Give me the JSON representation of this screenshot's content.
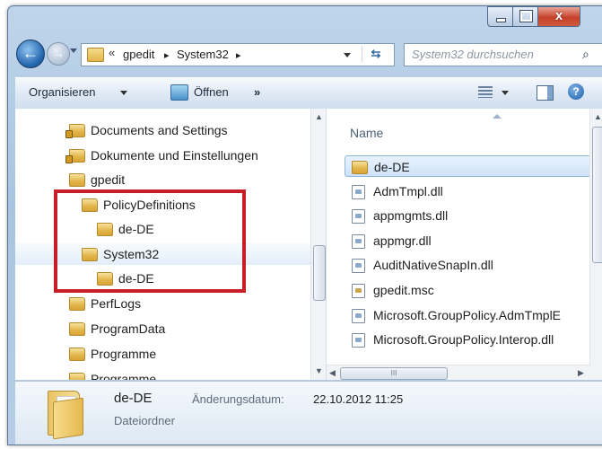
{
  "window": {
    "close_glyph": "x"
  },
  "nav": {
    "back_glyph": "←",
    "forward_glyph": "→",
    "address": {
      "prefix_chevron": "«",
      "segments": [
        "gpedit",
        "System32"
      ],
      "separator": "▸"
    },
    "refresh_glyph": "⇆",
    "search_placeholder": "System32 durchsuchen",
    "search_icon_glyph": "⌕"
  },
  "toolbar": {
    "organize_label": "Organisieren",
    "open_label": "Öffnen",
    "more_label": "»",
    "help_glyph": "?"
  },
  "tree": {
    "items": [
      {
        "label": "Documents and Settings",
        "locked": true
      },
      {
        "label": "Dokumente und Einstellungen",
        "locked": true
      },
      {
        "label": "gpedit",
        "locked": false
      },
      {
        "label": "PolicyDefinitions",
        "locked": false
      },
      {
        "label": "de-DE",
        "locked": false
      },
      {
        "label": "System32",
        "locked": false
      },
      {
        "label": "de-DE",
        "locked": false
      },
      {
        "label": "PerfLogs",
        "locked": false
      },
      {
        "label": "ProgramData",
        "locked": false
      },
      {
        "label": "Programme",
        "locked": false
      },
      {
        "label": "Programme",
        "locked": false
      }
    ]
  },
  "file_list": {
    "column_name": "Name",
    "items": [
      {
        "label": "de-DE",
        "kind": "folder",
        "selected": true
      },
      {
        "label": "AdmTmpl.dll",
        "kind": "dll"
      },
      {
        "label": "appmgmts.dll",
        "kind": "dll"
      },
      {
        "label": "appmgr.dll",
        "kind": "dll"
      },
      {
        "label": "AuditNativeSnapIn.dll",
        "kind": "dll"
      },
      {
        "label": "gpedit.msc",
        "kind": "msc"
      },
      {
        "label": "Microsoft.GroupPolicy.AdmTmplE",
        "kind": "dll"
      },
      {
        "label": "Microsoft.GroupPolicy.Interop.dll",
        "kind": "dll"
      }
    ],
    "hscroll_grip": "III"
  },
  "details": {
    "name": "de-DE",
    "type": "Dateiordner",
    "modified_label": "Änderungsdatum:",
    "modified_value": "22.10.2012 11:25"
  },
  "colors": {
    "highlight_box": "#c61f28",
    "selection": "#cfe2f8",
    "chrome": "#b7cde6"
  }
}
